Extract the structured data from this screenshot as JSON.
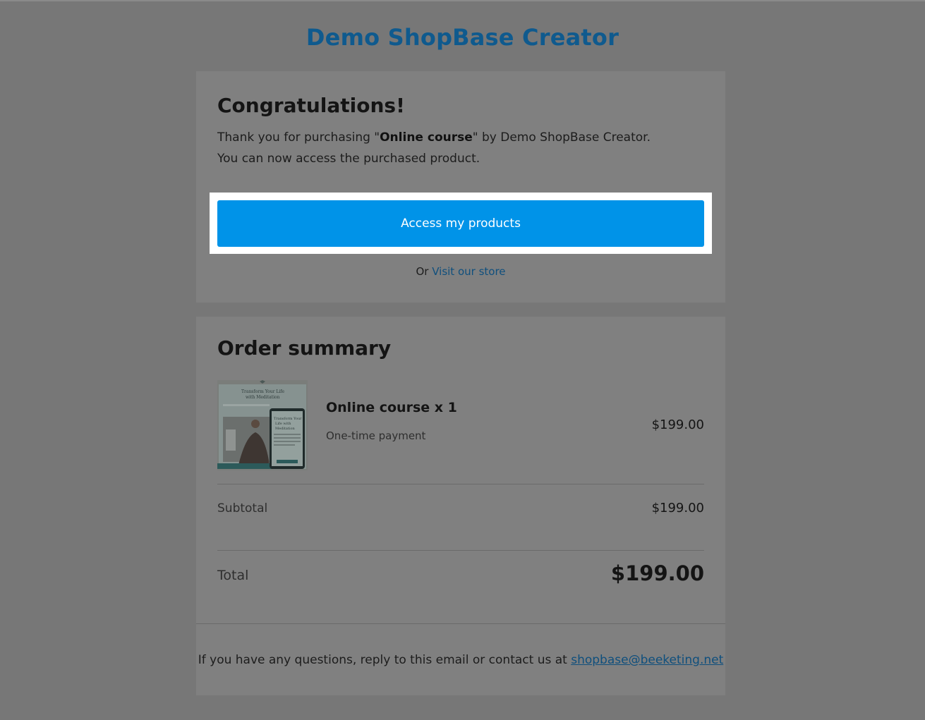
{
  "brand": {
    "title": "Demo ShopBase Creator"
  },
  "congrats": {
    "title": "Congratulations!",
    "line1_prefix": "Thank you for purchasing \"",
    "product_name": "Online course",
    "line1_suffix": "\" by Demo ShopBase Creator.",
    "line2": "You can now access the purchased product.",
    "access_button": "Access my products",
    "or_text": "Or ",
    "visit_store_link": "Visit our store"
  },
  "order": {
    "title": "Order summary",
    "item": {
      "name": "Online course x 1",
      "payment_type": "One-time payment",
      "price": "$199.00",
      "image_title": "Transform Your Life with Meditation"
    },
    "subtotal_label": "Subtotal",
    "subtotal_value": "$199.00",
    "total_label": "Total",
    "total_value": "$199.00"
  },
  "footer": {
    "text": "If you have any questions, reply to this email or contact us at ",
    "email": "shopbase@beeketing.net"
  },
  "colors": {
    "background": "#777777",
    "card": "#808080",
    "brand": "#0f5a8e",
    "button": "#0093e8",
    "link": "#0f4f7d"
  }
}
